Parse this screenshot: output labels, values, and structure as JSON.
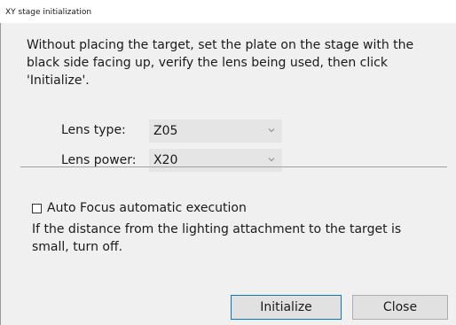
{
  "window": {
    "title": "XY stage initialization"
  },
  "instructions": "Without placing the target, set the plate on the stage with the black side facing up, verify the lens being used, then click 'Initialize'.",
  "lens_type": {
    "label": "Lens type:",
    "value": "Z05"
  },
  "lens_power": {
    "label": "Lens power:",
    "value": "X20"
  },
  "auto_focus": {
    "label": "Auto Focus automatic execution",
    "checked": false
  },
  "note": "If the distance from the lighting attachment to the target is small, turn off.",
  "buttons": {
    "initialize": "Initialize",
    "close": "Close"
  },
  "colors": {
    "default_button_border": "#0078d7",
    "combo_background": "#e5e5e5"
  }
}
